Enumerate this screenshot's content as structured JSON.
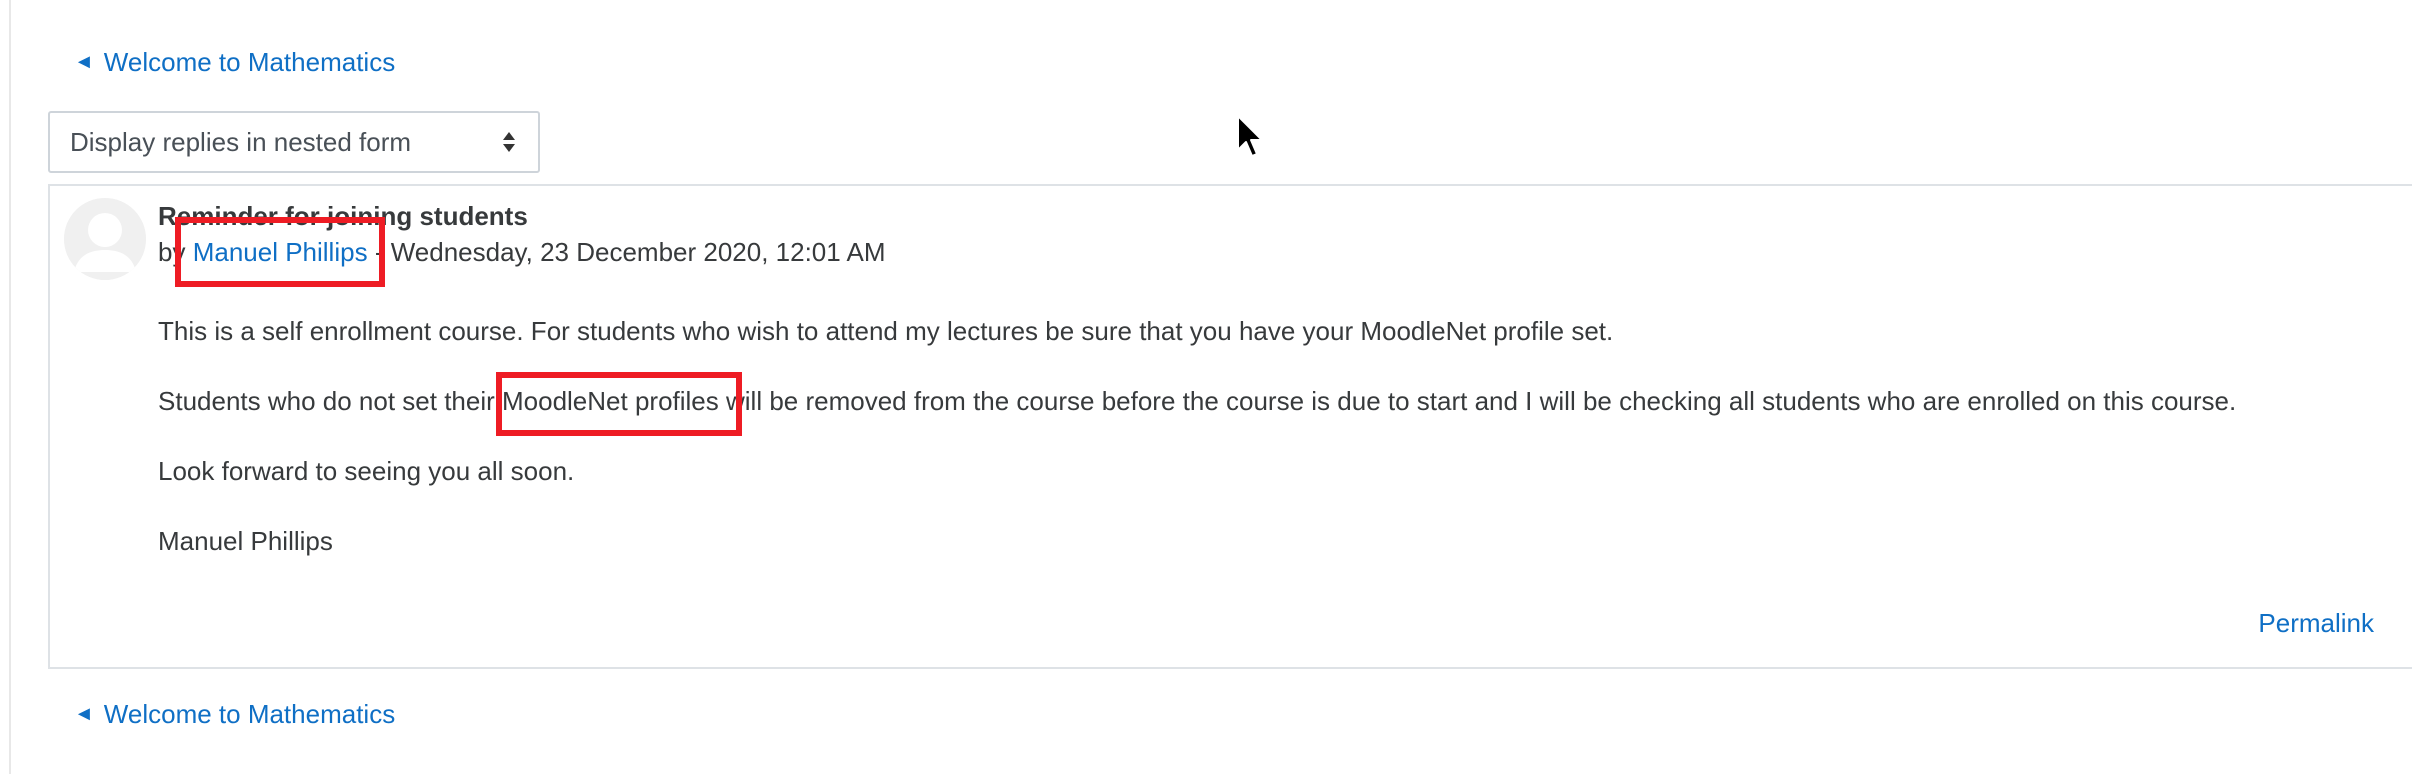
{
  "navigation": {
    "back_link_label": "Welcome to Mathematics",
    "back_arrow": "◄"
  },
  "display_mode": {
    "selected": "Display replies in nested form"
  },
  "post": {
    "subject": "Reminder for joining students",
    "by_prefix": "by",
    "author": "Manuel Phillips",
    "separator": "-",
    "date": "Wednesday, 23 December 2020, 12:01 AM",
    "paragraphs": [
      "This is a self enrollment course. For students who wish to attend my lectures be sure that you have your MoodleNet profile set.",
      "Students who do not set their MoodleNet profiles will be  removed from the course before the course is due to start and I will be checking all students who are enrolled on this course.",
      "Look forward to seeing you all soon.",
      "Manuel Phillips"
    ],
    "permalink_label": "Permalink"
  },
  "colors": {
    "link": "#0f6fc5",
    "text": "#373a3c",
    "highlight": "#ee1c24",
    "border": "#dee2e6"
  }
}
